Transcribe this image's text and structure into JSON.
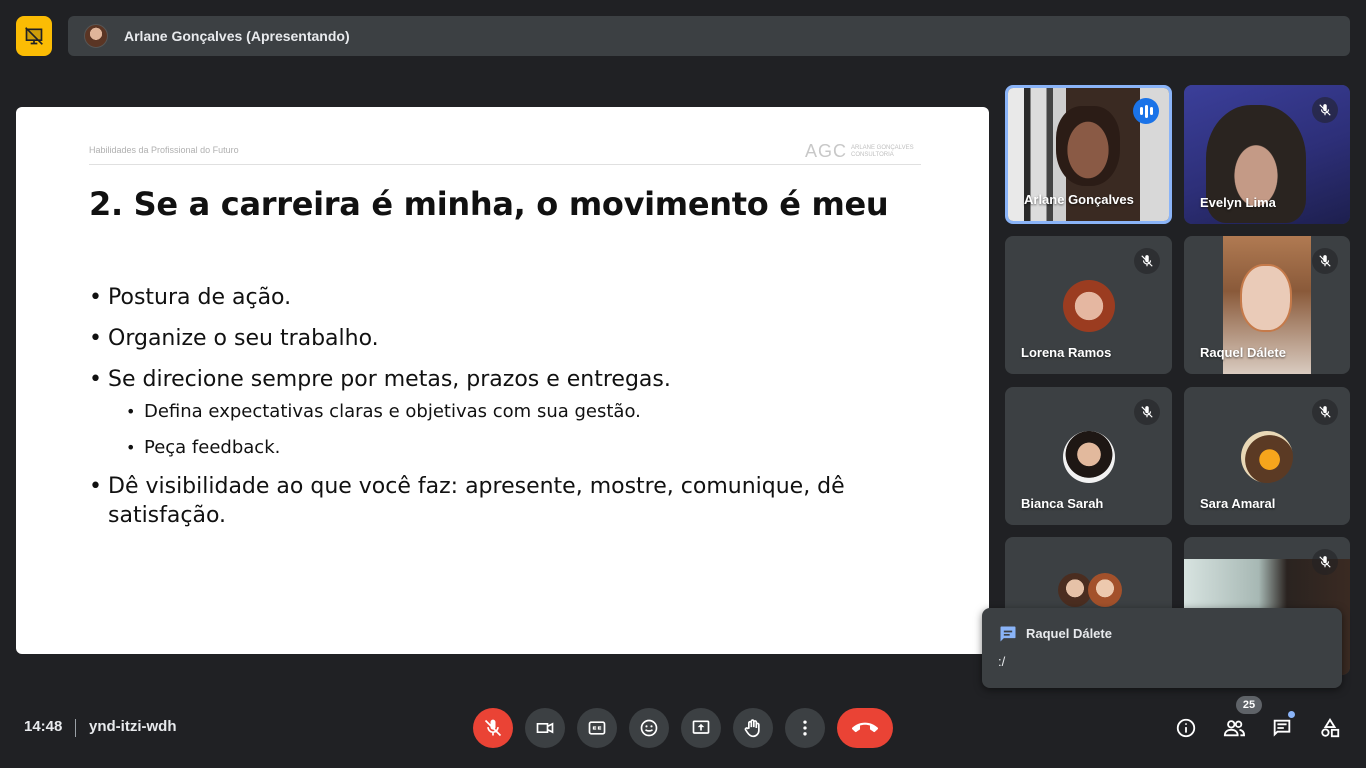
{
  "header": {
    "presenter_label": "Arlane Gonçalves (Apresentando)",
    "badge_icon": "presentation-off-icon"
  },
  "slide": {
    "subtitle": "Habilidades da Profissional do Futuro",
    "logo_mark": "AGC",
    "logo_text": "ARLANE GONÇALVES CONSULTORIA",
    "title": "2. Se a carreira é minha, o movimento é meu",
    "bullets": [
      "Postura de ação.",
      "Organize o seu trabalho.",
      "Se direcione sempre por metas, prazos e entregas.",
      "Dê visibilidade ao que você faz: apresente, mostre, comunique, dê satisfação."
    ],
    "sub_bullets": [
      "Defina expectativas claras e objetivas com sua gestão.",
      "Peça feedback."
    ]
  },
  "participants": [
    {
      "name": "Arlane Gonçalves",
      "state": "speaking"
    },
    {
      "name": "Evelyn Lima",
      "state": "muted"
    },
    {
      "name": "Lorena Ramos",
      "state": "muted"
    },
    {
      "name": "Raquel Dálete",
      "state": "muted"
    },
    {
      "name": "Bianca Sarah",
      "state": "muted"
    },
    {
      "name": "Sara Amaral",
      "state": "muted"
    },
    {
      "name": "",
      "state": "muted"
    }
  ],
  "toast": {
    "sender": "Raquel Dálete",
    "message": ":/"
  },
  "bottom": {
    "time": "14:48",
    "meeting_code": "ynd-itzi-wdh",
    "participant_count": "25"
  },
  "colors": {
    "background": "#202124",
    "tile": "#3c4043",
    "accent": "#8ab4f8",
    "danger": "#ea4335",
    "badge": "#fbbc04"
  }
}
